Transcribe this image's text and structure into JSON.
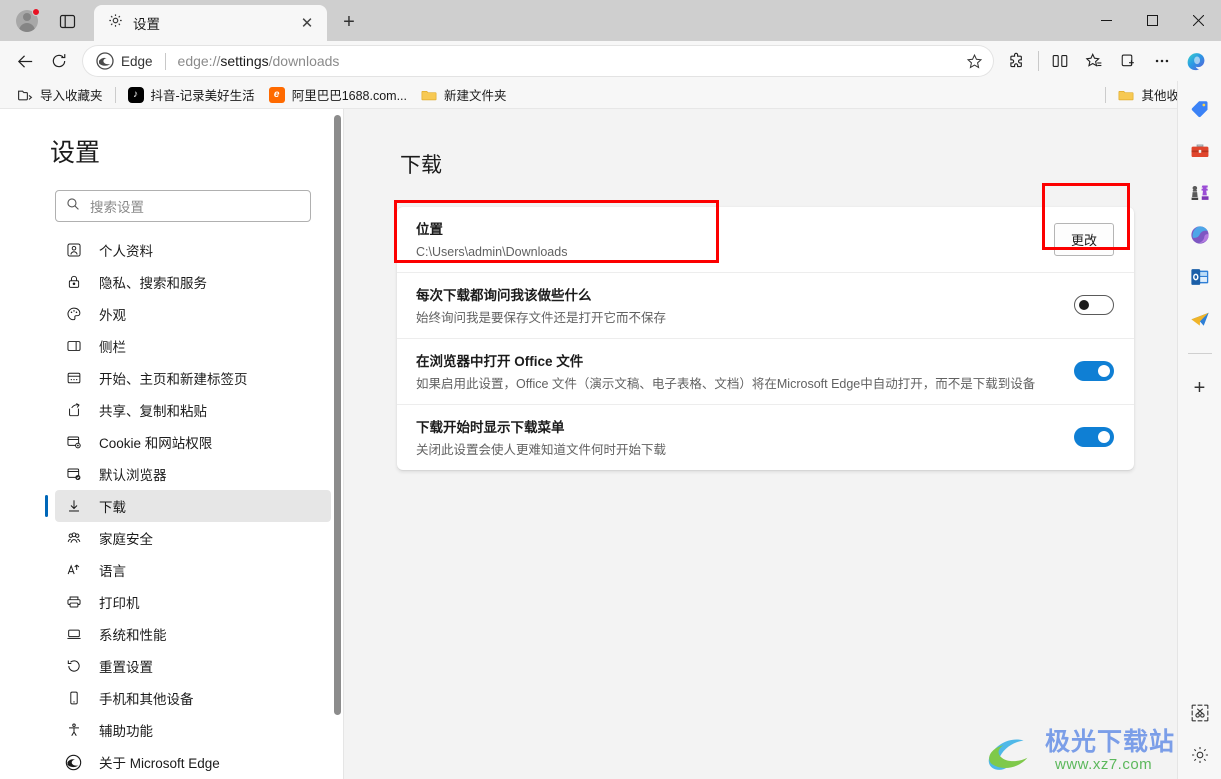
{
  "window": {
    "minimize_label": "—",
    "maximize_label": "□",
    "close_label": "✕"
  },
  "tabstrip": {
    "profile_icon": "account-avatar",
    "tab_list_icon": "tab-actions-icon",
    "tab": {
      "icon": "gear-icon",
      "title": "设置",
      "close_label": "✕"
    },
    "new_tab_label": "+"
  },
  "toolbar": {
    "back_icon": "back-arrow-icon",
    "refresh_icon": "refresh-icon",
    "omnibox": {
      "brand_icon": "edge-logo-icon",
      "brand_label": "Edge",
      "url_prefix": "edge://",
      "url_bold": "settings",
      "url_suffix": "/downloads",
      "full_url": "edge://settings/downloads",
      "favorite_icon": "star-outline-icon"
    },
    "icons": [
      {
        "name": "extensions-icon",
        "label": "扩展"
      },
      {
        "name": "split-screen-icon",
        "label": "分屏"
      },
      {
        "name": "favorites-icon",
        "label": "收藏夹"
      },
      {
        "name": "collections-icon",
        "label": "集锦"
      },
      {
        "name": "more-options-icon",
        "label": "设置及其他"
      },
      {
        "name": "copilot-icon",
        "label": "Copilot"
      }
    ]
  },
  "bookmarks": {
    "items": [
      {
        "label": "导入收藏夹",
        "icon": "import-favorites-icon"
      },
      {
        "label": "抖音-记录美好生活",
        "icon": "tiktok-icon",
        "glyph": "♪"
      },
      {
        "label": "阿里巴巴1688.com...",
        "icon": "alibaba-icon",
        "glyph": "e"
      },
      {
        "label": "新建文件夹",
        "icon": "folder-icon"
      }
    ],
    "other_favorites": {
      "label": "其他收藏夹",
      "icon": "folder-icon"
    }
  },
  "settings_nav": {
    "title": "设置",
    "search_placeholder": "搜索设置",
    "search_value": "",
    "search_icon": "search-icon",
    "items": [
      {
        "label": "个人资料",
        "icon": "profile-icon",
        "selected": false
      },
      {
        "label": "隐私、搜索和服务",
        "icon": "lock-icon",
        "selected": false
      },
      {
        "label": "外观",
        "icon": "palette-icon",
        "selected": false
      },
      {
        "label": "侧栏",
        "icon": "sidebar-icon",
        "selected": false
      },
      {
        "label": "开始、主页和新建标签页",
        "icon": "home-icon",
        "selected": false
      },
      {
        "label": "共享、复制和粘贴",
        "icon": "share-icon",
        "selected": false
      },
      {
        "label": "Cookie 和网站权限",
        "icon": "cookie-icon",
        "selected": false
      },
      {
        "label": "默认浏览器",
        "icon": "default-browser-icon",
        "selected": false
      },
      {
        "label": "下载",
        "icon": "download-icon",
        "selected": true
      },
      {
        "label": "家庭安全",
        "icon": "family-icon",
        "selected": false
      },
      {
        "label": "语言",
        "icon": "language-icon",
        "selected": false
      },
      {
        "label": "打印机",
        "icon": "printer-icon",
        "selected": false
      },
      {
        "label": "系统和性能",
        "icon": "system-icon",
        "selected": false
      },
      {
        "label": "重置设置",
        "icon": "reset-icon",
        "selected": false
      },
      {
        "label": "手机和其他设备",
        "icon": "phone-icon",
        "selected": false
      },
      {
        "label": "辅助功能",
        "icon": "accessibility-icon",
        "selected": false
      },
      {
        "label": "关于 Microsoft Edge",
        "icon": "edge-logo-icon",
        "selected": false
      }
    ]
  },
  "main": {
    "title": "下载",
    "rows": [
      {
        "name": "location",
        "title": "位置",
        "sub": "C:\\Users\\admin\\Downloads",
        "control": "button",
        "button_label": "更改"
      },
      {
        "name": "ask-where-to-save",
        "title": "每次下载都询问我该做些什么",
        "sub": "始终询问我是要保存文件还是打开它而不保存",
        "control": "toggle",
        "toggle_on": false
      },
      {
        "name": "open-office-files-in-browser",
        "title": "在浏览器中打开 Office 文件",
        "sub": "如果启用此设置，Office 文件（演示文稿、电子表格、文档）将在Microsoft Edge中自动打开，而不是下载到设备",
        "control": "toggle",
        "toggle_on": true
      },
      {
        "name": "show-downloads-menu-on-start",
        "title": "下载开始时显示下载菜单",
        "sub": "关闭此设置会使人更难知道文件何时开始下载",
        "control": "toggle",
        "toggle_on": true
      }
    ]
  },
  "edgebar": {
    "icons": [
      {
        "name": "shopping-tag-icon"
      },
      {
        "name": "tools-briefcase-icon"
      },
      {
        "name": "games-icon"
      },
      {
        "name": "microsoft365-icon"
      },
      {
        "name": "outlook-icon"
      },
      {
        "name": "telegram-plane-icon"
      }
    ],
    "add_label": "+",
    "bottom_icons": [
      {
        "name": "screenshot-crop-icon"
      },
      {
        "name": "settings-gear-icon"
      }
    ]
  },
  "watermark": {
    "main_text": "极光下载站",
    "sub_text": "www.xz7.com"
  },
  "colors": {
    "accent": "#0f7fd4",
    "nav_accent": "#0067b8",
    "annotation": "#fc0000",
    "page_bg": "#f3f3f3",
    "card_bg": "#ffffff"
  }
}
